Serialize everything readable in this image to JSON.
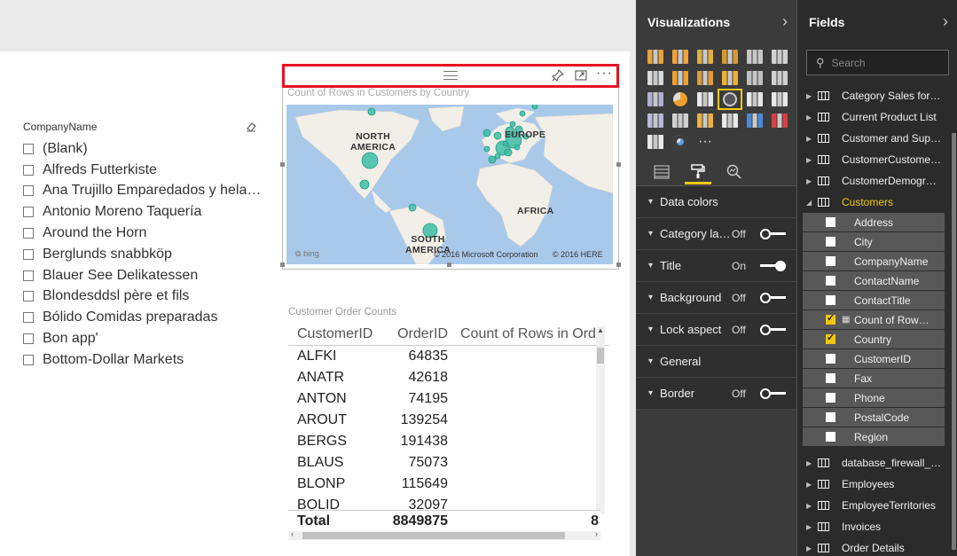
{
  "slicer": {
    "header": "CompanyName",
    "eraser_icon": "eraser-icon",
    "items": [
      "(Blank)",
      "Alfreds Futterkiste",
      "Ana Trujillo Emparedados y hela…",
      "Antonio Moreno Taquería",
      "Around the Horn",
      "Berglunds snabbköp",
      "Blauer See Delikatessen",
      "Blondesddsl père et fils",
      "Bólido Comidas preparadas",
      "Bon app'",
      "Bottom-Dollar Markets"
    ]
  },
  "map_visual": {
    "title": "Count of Rows in Customers by Country",
    "header_icons": [
      "pin-icon",
      "focus-mode-icon",
      "more-options-icon"
    ],
    "labels": {
      "north_america": "NORTH\nAMERICA",
      "europe": "EUROPE",
      "africa": "AFRICA",
      "south_america": "SOUTH\nAMERICA"
    },
    "bing": "bing",
    "credit_ms": "© 2016 Microsoft Corporation",
    "credit_here": "© 2016 HERE"
  },
  "table_visual": {
    "title": "Customer Order Counts",
    "columns": [
      "CustomerID",
      "OrderID",
      "Count of Rows in Orde"
    ],
    "rows": [
      [
        "ALFKI",
        "64835",
        ""
      ],
      [
        "ANATR",
        "42618",
        ""
      ],
      [
        "ANTON",
        "74195",
        ""
      ],
      [
        "AROUT",
        "139254",
        ""
      ],
      [
        "BERGS",
        "191438",
        ""
      ],
      [
        "BLAUS",
        "75073",
        ""
      ],
      [
        "BLONP",
        "115649",
        ""
      ],
      [
        "BOLID",
        "32097",
        ""
      ]
    ],
    "total": [
      "Total",
      "8849875",
      "8"
    ]
  },
  "visualizations": {
    "title": "Visualizations",
    "format_items": [
      {
        "label": "Data colors",
        "state": "",
        "toggle": ""
      },
      {
        "label": "Category la…",
        "state": "Off",
        "toggle": "off"
      },
      {
        "label": "Title",
        "state": "On",
        "toggle": "on"
      },
      {
        "label": "Background",
        "state": "Off",
        "toggle": "off"
      },
      {
        "label": "Lock aspect",
        "state": "Off",
        "toggle": "off"
      },
      {
        "label": "General",
        "state": "",
        "toggle": ""
      },
      {
        "label": "Border",
        "state": "Off",
        "toggle": "off"
      }
    ],
    "more_glyph": "···"
  },
  "fields": {
    "title": "Fields",
    "search_placeholder": "Search",
    "tables_before": [
      "Category Sales for…",
      "Current Product List",
      "Customer and Sup…",
      "CustomerCustome…",
      "CustomerDemogr…"
    ],
    "expanded_table": "Customers",
    "customer_fields": [
      {
        "name": "Address",
        "checked": false,
        "calc": false
      },
      {
        "name": "City",
        "checked": false,
        "calc": false
      },
      {
        "name": "CompanyName",
        "checked": false,
        "calc": false
      },
      {
        "name": "ContactName",
        "checked": false,
        "calc": false
      },
      {
        "name": "ContactTitle",
        "checked": false,
        "calc": false
      },
      {
        "name": "Count of Row…",
        "checked": true,
        "calc": true
      },
      {
        "name": "Country",
        "checked": true,
        "calc": false
      },
      {
        "name": "CustomerID",
        "checked": false,
        "calc": false
      },
      {
        "name": "Fax",
        "checked": false,
        "calc": false
      },
      {
        "name": "Phone",
        "checked": false,
        "calc": false
      },
      {
        "name": "PostalCode",
        "checked": false,
        "calc": false
      },
      {
        "name": "Region",
        "checked": false,
        "calc": false
      }
    ],
    "tables_after": [
      "database_firewall_…",
      "Employees",
      "EmployeeTerritories",
      "Invoices",
      "Order Details"
    ]
  },
  "colors": {
    "accent": "#f2c811",
    "focus_border": "#e81123",
    "bubble": "#3dbda7",
    "land": "#f2efe8",
    "water": "#a9c9ea"
  }
}
